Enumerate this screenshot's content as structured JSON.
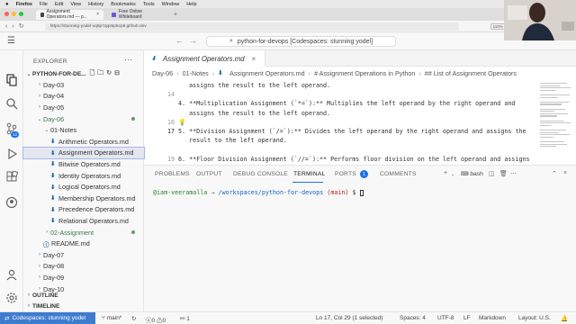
{
  "os_menubar": {
    "apple": "",
    "items": [
      "Firefox",
      "File",
      "Edit",
      "View",
      "History",
      "Bookmarks",
      "Tools",
      "Window",
      "Help"
    ]
  },
  "browser": {
    "tabs": [
      {
        "label": "Assignment Operators.md — p...",
        "active": true
      },
      {
        "label": "Free Online Whiteboard",
        "active": false
      }
    ],
    "url": "https://stunning-yodel-vq6p7qqx5p5cp9.github.dev",
    "zoom": "110%"
  },
  "titlebar": {
    "command_center": "python-for-devops [Codespaces: stunning yodel]"
  },
  "activity_bar": {
    "badge_count": "12"
  },
  "explorer": {
    "title": "EXPLORER",
    "root": "PYTHON-FOR-DE...",
    "rows": [
      {
        "label": "Day-03",
        "indent": 1,
        "kind": "folder",
        "open": false
      },
      {
        "label": "Day-04",
        "indent": 1,
        "kind": "folder",
        "open": false
      },
      {
        "label": "Day-05",
        "indent": 1,
        "kind": "folder",
        "open": false
      },
      {
        "label": "Day-06",
        "indent": 1,
        "kind": "folder",
        "open": true,
        "modified": true
      },
      {
        "label": "01-Notes",
        "indent": 2,
        "kind": "folder",
        "open": true
      },
      {
        "label": "Arithmetic Operators.md",
        "indent": 3,
        "kind": "md"
      },
      {
        "label": "Assignment Operators.md",
        "indent": 3,
        "kind": "md",
        "selected": true
      },
      {
        "label": "Bitwise Operators.md",
        "indent": 3,
        "kind": "md"
      },
      {
        "label": "Identity Operators.md",
        "indent": 3,
        "kind": "md"
      },
      {
        "label": "Logical Operators.md",
        "indent": 3,
        "kind": "md"
      },
      {
        "label": "Membership Operators.md",
        "indent": 3,
        "kind": "md"
      },
      {
        "label": "Precedence Operators.md",
        "indent": 3,
        "kind": "md"
      },
      {
        "label": "Relational Operators.md",
        "indent": 3,
        "kind": "md"
      },
      {
        "label": "02-Assignment",
        "indent": 2,
        "kind": "folder",
        "open": false,
        "modified": true
      },
      {
        "label": "README.md",
        "indent": 2,
        "kind": "info"
      },
      {
        "label": "Day-07",
        "indent": 1,
        "kind": "folder",
        "open": false
      },
      {
        "label": "Day-08",
        "indent": 1,
        "kind": "folder",
        "open": false
      },
      {
        "label": "Day-09",
        "indent": 1,
        "kind": "folder",
        "open": false
      },
      {
        "label": "Day-10",
        "indent": 1,
        "kind": "folder",
        "open": false
      }
    ],
    "sections": [
      "OUTLINE",
      "TIMELINE"
    ]
  },
  "editor": {
    "tab_label": "Assignment Operators.md",
    "breadcrumb": [
      "Day-06",
      "01-Notes",
      "Assignment Operators.md",
      "# Assignment Operations in Python",
      "## List of Assignment Operators"
    ],
    "lines": [
      {
        "num": "",
        "text": "   assigns the result to the left operand."
      },
      {
        "num": "14",
        "text": ""
      },
      {
        "num": "",
        "text": "4. **Multiplication Assignment (`*=`):** Multiplies the left operand by the right operand and"
      },
      {
        "num": "",
        "text": "   assigns the result to the left operand."
      },
      {
        "num": "16",
        "text": ""
      },
      {
        "num": "17",
        "text": "5. **Division Assignment (`/=`):** Divides the left operand by the right operand and assigns the"
      },
      {
        "num": "",
        "text": "   result to the left operand."
      },
      {
        "num": "",
        "text": ""
      },
      {
        "num": "19",
        "text": "6. **Floor Division Assignment (`//=`):** Performs floor division on the left operand and assigns"
      },
      {
        "num": "",
        "text": "   the result to the left operand."
      }
    ]
  },
  "panel": {
    "tabs": [
      "PROBLEMS",
      "OUTPUT",
      "DEBUG CONSOLE",
      "TERMINAL",
      "PORTS",
      "COMMENTS"
    ],
    "active_tab": "TERMINAL",
    "ports_badge": "1",
    "shell": "bash",
    "terminal_user": "@iam-veeramalla",
    "terminal_arrow": "→",
    "terminal_path": "/workspaces/python-for-devops",
    "terminal_branch": "(main)",
    "terminal_prompt": "$"
  },
  "statusbar": {
    "remote": "Codespaces: stunning yodel",
    "branch": "main*",
    "errors": "0",
    "warnings": "0",
    "ports": "1",
    "cursor": "Ln 17, Col 29 (1 selected)",
    "spaces": "Spaces: 4",
    "encoding": "UTF-8",
    "eol": "LF",
    "language": "Markdown",
    "layout": "Layout: U.S."
  },
  "colors": {
    "accent": "#1a73e8",
    "remote_bg": "#3f7bcf",
    "git_modified": "#5a9e6c",
    "md_icon": "#1d6ba8",
    "terminal_green": "#2e7d32",
    "terminal_blue": "#1565c0"
  }
}
